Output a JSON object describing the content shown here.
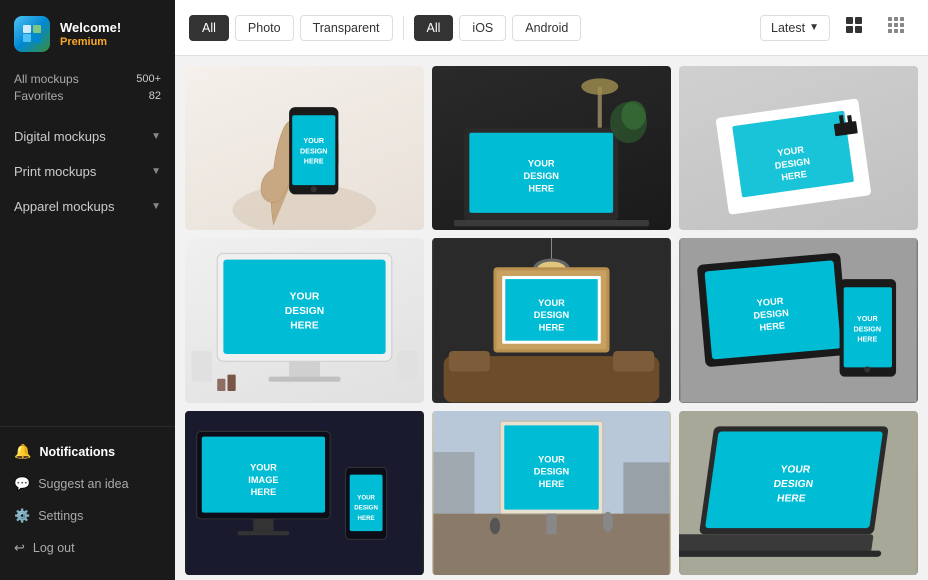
{
  "sidebar": {
    "logo": {
      "title": "Welcome!",
      "subtitle": "Premium"
    },
    "stats": [
      {
        "label": "All mockups",
        "value": "500+"
      },
      {
        "label": "Favorites",
        "value": "82"
      }
    ],
    "nav_items": [
      {
        "label": "Digital mockups",
        "has_arrow": true
      },
      {
        "label": "Print mockups",
        "has_arrow": true
      },
      {
        "label": "Apparel mockups",
        "has_arrow": true
      }
    ],
    "bottom_items": [
      {
        "label": "Notifications",
        "icon": "bell",
        "active": true
      },
      {
        "label": "Suggest an idea",
        "icon": "chat"
      },
      {
        "label": "Settings",
        "icon": "gear"
      },
      {
        "label": "Log out",
        "icon": "logout"
      }
    ]
  },
  "toolbar": {
    "filters_left": [
      {
        "label": "All",
        "active": true
      },
      {
        "label": "Photo",
        "active": false
      },
      {
        "label": "Transparent",
        "active": false
      }
    ],
    "filters_right": [
      {
        "label": "All",
        "active": true
      },
      {
        "label": "iOS",
        "active": false
      },
      {
        "label": "Android",
        "active": false
      }
    ],
    "sort_label": "Latest",
    "view_grid_icon": "grid-2x2",
    "view_dots_icon": "grid-3x3"
  },
  "mockups": {
    "design_text": "YOUR\nDESIGN\nHERE",
    "items": [
      {
        "id": 1,
        "theme": "light-warm"
      },
      {
        "id": 2,
        "theme": "dark"
      },
      {
        "id": 3,
        "theme": "gray"
      },
      {
        "id": 4,
        "theme": "white"
      },
      {
        "id": 5,
        "theme": "dark-room"
      },
      {
        "id": 6,
        "theme": "multi-device"
      },
      {
        "id": 7,
        "theme": "outdoor-dark"
      },
      {
        "id": 8,
        "theme": "outdoor-light"
      },
      {
        "id": 9,
        "theme": "laptop-gray"
      }
    ]
  }
}
